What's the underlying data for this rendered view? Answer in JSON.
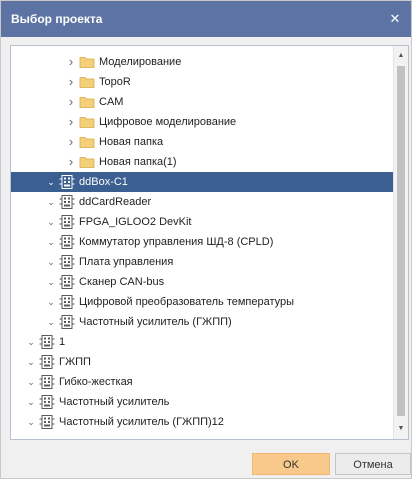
{
  "dialog": {
    "title": "Выбор проекта",
    "close_glyph": "✕",
    "ok_label": "OK",
    "cancel_label": "Отмена"
  },
  "icons": {
    "folder_color": "#f3cf7a",
    "project_color": "#5a5a5a"
  },
  "tree": {
    "items": [
      {
        "label": "Моделирование",
        "icon": "folder",
        "level": 2,
        "expanded": false,
        "selected": false
      },
      {
        "label": "TopoR",
        "icon": "folder",
        "level": 2,
        "expanded": false,
        "selected": false
      },
      {
        "label": "CAM",
        "icon": "folder",
        "level": 2,
        "expanded": false,
        "selected": false
      },
      {
        "label": "Цифровое моделирование",
        "icon": "folder",
        "level": 2,
        "expanded": false,
        "selected": false
      },
      {
        "label": "Новая папка",
        "icon": "folder",
        "level": 2,
        "expanded": false,
        "selected": false
      },
      {
        "label": "Новая папка(1)",
        "icon": "folder",
        "level": 2,
        "expanded": false,
        "selected": false
      },
      {
        "label": "ddBox-C1",
        "icon": "project",
        "level": 1,
        "expanded": true,
        "selected": true
      },
      {
        "label": "ddCardReader",
        "icon": "project",
        "level": 1,
        "expanded": true,
        "selected": false
      },
      {
        "label": "FPGA_IGLOO2 DevKit",
        "icon": "project",
        "level": 1,
        "expanded": true,
        "selected": false
      },
      {
        "label": "Коммутатор управления ШД-8 (CPLD)",
        "icon": "project",
        "level": 1,
        "expanded": true,
        "selected": false
      },
      {
        "label": "Плата управления",
        "icon": "project",
        "level": 1,
        "expanded": true,
        "selected": false
      },
      {
        "label": "Сканер CAN-bus",
        "icon": "project",
        "level": 1,
        "expanded": true,
        "selected": false
      },
      {
        "label": "Цифровой преобразователь температуры",
        "icon": "project",
        "level": 1,
        "expanded": true,
        "selected": false
      },
      {
        "label": "Частотный усилитель (ГЖПП)",
        "icon": "project",
        "level": 1,
        "expanded": true,
        "selected": false
      },
      {
        "label": "1",
        "icon": "project",
        "level": 0,
        "expanded": true,
        "selected": false
      },
      {
        "label": "ГЖПП",
        "icon": "project",
        "level": 0,
        "expanded": true,
        "selected": false
      },
      {
        "label": "Гибко-жесткая",
        "icon": "project",
        "level": 0,
        "expanded": true,
        "selected": false
      },
      {
        "label": "Частотный усилитель",
        "icon": "project",
        "level": 0,
        "expanded": true,
        "selected": false
      },
      {
        "label": "Частотный усилитель (ГЖПП)12",
        "icon": "project",
        "level": 0,
        "expanded": true,
        "selected": false
      }
    ]
  }
}
